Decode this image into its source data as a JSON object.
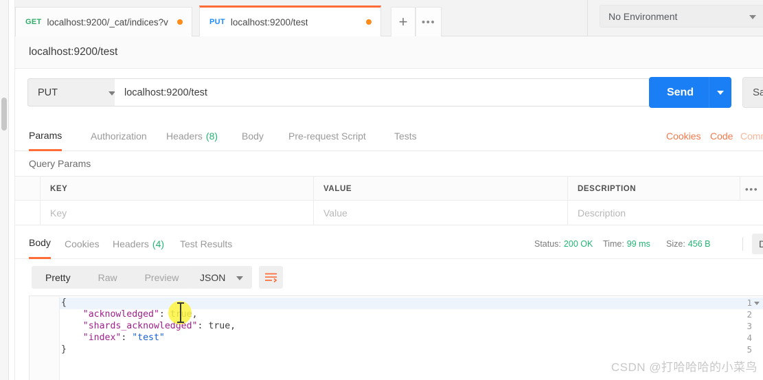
{
  "tabs": {
    "items": [
      {
        "method": "GET",
        "url": "localhost:9200/_cat/indices?v",
        "active": false,
        "unsaved": true
      },
      {
        "method": "PUT",
        "url": "localhost:9200/test",
        "active": true,
        "unsaved": true
      }
    ],
    "new_tab_label": "+",
    "more_label": "•••"
  },
  "environment": {
    "selected": "No Environment",
    "eye_icon": "eye-icon"
  },
  "request": {
    "name": "localhost:9200/test",
    "method": "PUT",
    "url": "localhost:9200/test",
    "send_label": "Send",
    "save_label": "Save",
    "tabs": [
      {
        "label": "Params",
        "badge": "",
        "active": true
      },
      {
        "label": "Authorization",
        "badge": "",
        "active": false
      },
      {
        "label": "Headers",
        "badge": "(8)",
        "active": false
      },
      {
        "label": "Body",
        "badge": "",
        "active": false
      },
      {
        "label": "Pre-request Script",
        "badge": "",
        "active": false
      },
      {
        "label": "Tests",
        "badge": "",
        "active": false
      }
    ],
    "links": [
      {
        "label": "Cookies",
        "faded": false
      },
      {
        "label": "Code",
        "faded": false
      },
      {
        "label": "Comm",
        "faded": true
      }
    ]
  },
  "query_params": {
    "title": "Query Params",
    "columns": [
      "KEY",
      "VALUE",
      "DESCRIPTION"
    ],
    "options_icon": "•••",
    "rows": [
      {
        "key": "Key",
        "value": "Value",
        "description": "Description"
      }
    ]
  },
  "response": {
    "tabs": [
      {
        "label": "Body",
        "badge": "",
        "active": true
      },
      {
        "label": "Cookies",
        "badge": "",
        "active": false
      },
      {
        "label": "Headers",
        "badge": "(4)",
        "active": false
      },
      {
        "label": "Test Results",
        "badge": "",
        "active": false
      }
    ],
    "status_label": "Status:",
    "status_value": "200 OK",
    "time_label": "Time:",
    "time_value": "99 ms",
    "size_label": "Size:",
    "size_value": "456 B",
    "download_label": "Download",
    "view_modes": [
      {
        "label": "Pretty",
        "active": true
      },
      {
        "label": "Raw",
        "active": false
      },
      {
        "label": "Preview",
        "active": false
      }
    ],
    "format": "JSON",
    "wrap_icon": "wrap-lines-icon",
    "body_lines": [
      {
        "num": "1",
        "foldable": true,
        "indent": 0,
        "tokens": [
          {
            "t": "{",
            "c": "p"
          }
        ]
      },
      {
        "num": "2",
        "foldable": false,
        "indent": 1,
        "tokens": [
          {
            "t": "\"acknowledged\"",
            "c": "k"
          },
          {
            "t": ": ",
            "c": "p"
          },
          {
            "t": "true,",
            "c": "b"
          }
        ]
      },
      {
        "num": "3",
        "foldable": false,
        "indent": 1,
        "tokens": [
          {
            "t": "\"shards_acknowledged\"",
            "c": "k"
          },
          {
            "t": ": ",
            "c": "p"
          },
          {
            "t": "true,",
            "c": "b"
          }
        ]
      },
      {
        "num": "4",
        "foldable": false,
        "indent": 1,
        "tokens": [
          {
            "t": "\"index\"",
            "c": "k"
          },
          {
            "t": ": ",
            "c": "p"
          },
          {
            "t": "\"test\"",
            "c": "s"
          }
        ]
      },
      {
        "num": "5",
        "foldable": false,
        "indent": 0,
        "tokens": [
          {
            "t": "}",
            "c": "p"
          }
        ]
      }
    ]
  },
  "watermark": "CSDN @打哈哈哈的小菜鸟",
  "colors": {
    "accent_orange": "#ff6c37",
    "send_blue": "#1a7ef4",
    "status_green": "#21b573",
    "get_green": "#2eac68",
    "put_blue": "#1a8cff"
  }
}
